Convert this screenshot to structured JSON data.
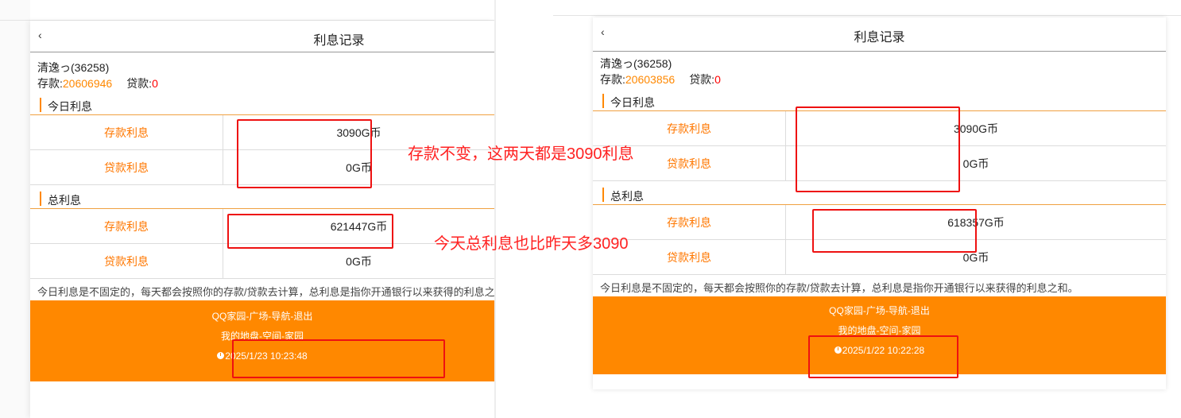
{
  "screens": [
    {
      "back": "‹",
      "title": "利息记录",
      "user_name": "清逸っ(36258)",
      "deposit_label": "存款:",
      "deposit_value": "20606946",
      "loan_label": "贷款:",
      "loan_value": "0",
      "today_section": "今日利息",
      "today_rows": [
        {
          "label": "存款利息",
          "value": "3090G币"
        },
        {
          "label": "贷款利息",
          "value": "0G币"
        }
      ],
      "total_section": "总利息",
      "total_rows": [
        {
          "label": "存款利息",
          "value": "621447G币"
        },
        {
          "label": "贷款利息",
          "value": "0G币"
        }
      ],
      "notice": "今日利息是不固定的，每天都会按照你的存款/贷款去计算，总利息是指你开通银行以来获得的利息之和。",
      "footer_nav": "QQ家园-广场-导航-退出",
      "footer_links": "我的地盘-空间-家园",
      "timestamp": "2025/1/23 10:23:48"
    },
    {
      "back": "‹",
      "title": "利息记录",
      "user_name": "清逸っ(36258)",
      "deposit_label": "存款:",
      "deposit_value": "20603856",
      "loan_label": "贷款:",
      "loan_value": "0",
      "today_section": "今日利息",
      "today_rows": [
        {
          "label": "存款利息",
          "value": "3090G币"
        },
        {
          "label": "贷款利息",
          "value": "0G币"
        }
      ],
      "total_section": "总利息",
      "total_rows": [
        {
          "label": "存款利息",
          "value": "618357G币"
        },
        {
          "label": "贷款利息",
          "value": "0G币"
        }
      ],
      "notice": "今日利息是不固定的，每天都会按照你的存款/贷款去计算，总利息是指你开通银行以来获得的利息之和。",
      "footer_nav": "QQ家园-广场-导航-退出",
      "footer_links": "我的地盘-空间-家园",
      "timestamp": "2025/1/22 10:22:28"
    }
  ],
  "annotations": {
    "note1": "存款不变，这两天都是3090利息",
    "note2": "今天总利息也比昨天多3090"
  },
  "colors": {
    "accent": "#ff8800",
    "annotation_red": "#ff2222",
    "highlight_box": "#ee1111"
  }
}
